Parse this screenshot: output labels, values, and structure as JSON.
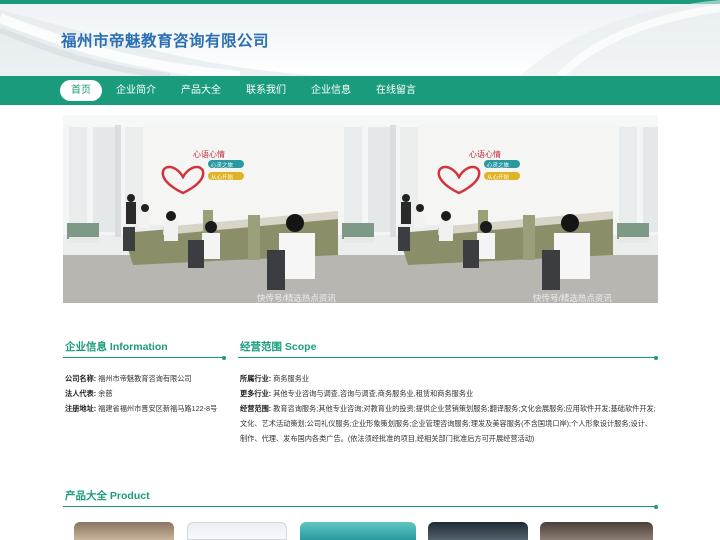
{
  "header": {
    "site_title": "福州市帝魅教育咨询有限公司"
  },
  "nav": {
    "items": [
      {
        "label": "首页",
        "active": true
      },
      {
        "label": "企业简介"
      },
      {
        "label": "产品大全"
      },
      {
        "label": "联系我们"
      },
      {
        "label": "企业信息"
      },
      {
        "label": "在线留言"
      }
    ]
  },
  "banner": {
    "wall_text": "心语心情",
    "slogan_1": "心灵之旅",
    "slogan_2": "从心开始",
    "watermark_1": "快传号/精选热点资讯",
    "watermark_2": "快传号/精选热点资讯"
  },
  "company_info": {
    "title": "企业信息 Information",
    "rows": [
      {
        "label": "公司名称:",
        "value": "福州市帝魅教育咨询有限公司"
      },
      {
        "label": "法人代表:",
        "value": "余慈"
      },
      {
        "label": "注册地址:",
        "value": "福建省福州市晋安区新福马路122-8号"
      }
    ]
  },
  "scope": {
    "title": "经营范围 Scope",
    "industry_label": "所属行业:",
    "industry_value": "商务服务业",
    "more_label": "更多行业:",
    "more_value": "其他专业咨询与调查,咨询与调查,商务服务业,租赁和商务服务业",
    "scope_label": "经营范围:",
    "scope_value": "教育咨询服务;其他专业咨询;对教育业的投资;提供企业营销策划服务;翻译服务;文化会展服务;应用软件开发;基础软件开发;文化、艺术活动策划;公司礼仪服务;企业形象策划服务;企业管理咨询服务;理发及美容服务(不含国境口岸);个人形象设计服务;设计、制作、代理、发布国内各类广告。(依法须经批准的项目,经相关部门批准后方可开展经营活动)"
  },
  "products": {
    "title": "产品大全 Product"
  },
  "colors": {
    "accent": "#1a9c7c",
    "title_blue": "#2a6fb4"
  }
}
